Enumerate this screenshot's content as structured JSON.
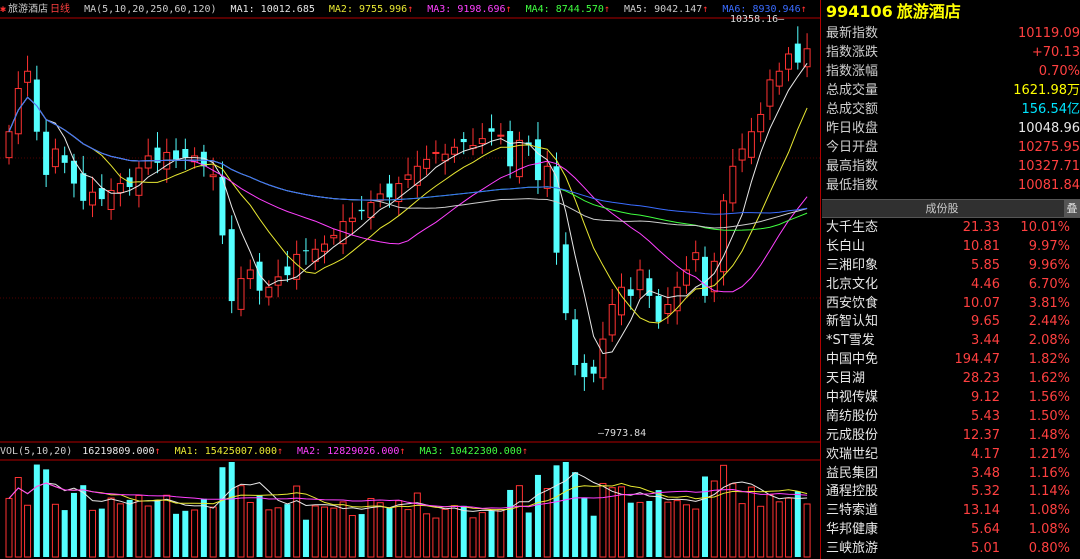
{
  "chart": {
    "name": "旅游酒店",
    "period": "日线",
    "ma_params": "MA(5,10,20,250,60,120)",
    "ma": [
      {
        "label": "MA1:",
        "value": "10012.685"
      },
      {
        "label": "MA2:",
        "value": "9755.996"
      },
      {
        "label": "MA3:",
        "value": "9198.696"
      },
      {
        "label": "MA4:",
        "value": "8744.570"
      },
      {
        "label": "MA5:",
        "value": "9042.147"
      },
      {
        "label": "MA6:",
        "value": "8930.946"
      }
    ],
    "high_annotation": "10358.16",
    "low_annotation": "7973.84",
    "arrow": "↑"
  },
  "volume": {
    "params": "VOL(5,10,20)",
    "value": "16219809.000",
    "ma": [
      {
        "label": "MA1:",
        "value": "15425007.000"
      },
      {
        "label": "MA2:",
        "value": "12829026.000"
      },
      {
        "label": "MA3:",
        "value": "10422300.000"
      }
    ]
  },
  "chart_data": {
    "type": "candlestick",
    "price_range": [
      7973.84,
      10358.16
    ],
    "series": [
      {
        "name": "MA1",
        "color": "#e8e8e8"
      },
      {
        "name": "MA2",
        "color": "#e8e832"
      },
      {
        "name": "MA3",
        "color": "#ff40ff"
      },
      {
        "name": "MA4",
        "color": "#40ff40"
      },
      {
        "name": "MA5",
        "color": "#cccccc"
      },
      {
        "name": "MA6",
        "color": "#3a6cff"
      }
    ],
    "closes": [
      9700,
      9950,
      10050,
      9700,
      9450,
      9600,
      9520,
      9400,
      9300,
      9350,
      9310,
      9360,
      9400,
      9380,
      9490,
      9560,
      9520,
      9580,
      9540,
      9550,
      9560,
      9500,
      9450,
      9100,
      8720,
      8850,
      8900,
      8780,
      8800,
      8860,
      8870,
      8990,
      9010,
      9020,
      9050,
      9100,
      9180,
      9200,
      9240,
      9290,
      9340,
      9320,
      9400,
      9450,
      9500,
      9540,
      9580,
      9570,
      9610,
      9640,
      9620,
      9660,
      9700,
      9680,
      9500,
      9650,
      9620,
      9420,
      9500,
      9000,
      8650,
      8350,
      8280,
      8300,
      8500,
      8700,
      8800,
      8750,
      8900,
      8750,
      8600,
      8700,
      8800,
      8900,
      9000,
      8750,
      8950,
      9300,
      9500,
      9600,
      9700,
      9800,
      10000,
      10050,
      10150,
      10100,
      10180
    ]
  },
  "panel": {
    "code": "994106",
    "name": "旅游酒店",
    "quotes": [
      {
        "label": "最新指数",
        "value": "10119.09",
        "tone": "red"
      },
      {
        "label": "指数涨跌",
        "value": "+70.13",
        "tone": "red"
      },
      {
        "label": "指数涨幅",
        "value": "0.70%",
        "tone": "red"
      },
      {
        "label": "总成交量",
        "value": "1621.98万",
        "tone": "yel"
      },
      {
        "label": "总成交额",
        "value": "156.54亿",
        "tone": "cya"
      },
      {
        "label": "昨日收盘",
        "value": "10048.96",
        "tone": "wht"
      },
      {
        "label": "今日开盘",
        "value": "10275.95",
        "tone": "red"
      },
      {
        "label": "最高指数",
        "value": "10327.71",
        "tone": "red"
      },
      {
        "label": "最低指数",
        "value": "10081.84",
        "tone": "red"
      }
    ],
    "tab": "成份股",
    "stack": "叠",
    "constituents": [
      {
        "name": "大千生态",
        "price": "21.33",
        "pct": "10.01%"
      },
      {
        "name": "长白山",
        "price": "10.81",
        "pct": "9.97%"
      },
      {
        "name": "三湘印象",
        "price": "5.85",
        "pct": "9.96%"
      },
      {
        "name": "北京文化",
        "price": "4.46",
        "pct": "6.70%"
      },
      {
        "name": "西安饮食",
        "price": "10.07",
        "pct": "3.81%"
      },
      {
        "name": "新智认知",
        "price": "9.65",
        "pct": "2.44%"
      },
      {
        "name": "*ST雪发",
        "price": "3.44",
        "pct": "2.08%"
      },
      {
        "name": "中国中免",
        "price": "194.47",
        "pct": "1.82%"
      },
      {
        "name": "天目湖",
        "price": "28.23",
        "pct": "1.62%"
      },
      {
        "name": "中视传媒",
        "price": "9.12",
        "pct": "1.56%"
      },
      {
        "name": "南纺股份",
        "price": "5.43",
        "pct": "1.50%"
      },
      {
        "name": "元成股份",
        "price": "12.37",
        "pct": "1.48%"
      },
      {
        "name": "欢瑞世纪",
        "price": "4.17",
        "pct": "1.21%"
      },
      {
        "name": "益民集团",
        "price": "3.48",
        "pct": "1.16%"
      },
      {
        "name": "通程控股",
        "price": "5.32",
        "pct": "1.14%"
      },
      {
        "name": "三特索道",
        "price": "13.14",
        "pct": "1.08%"
      },
      {
        "name": "华邦健康",
        "price": "5.64",
        "pct": "1.08%"
      },
      {
        "name": "三峡旅游",
        "price": "5.01",
        "pct": "0.80%"
      }
    ]
  }
}
